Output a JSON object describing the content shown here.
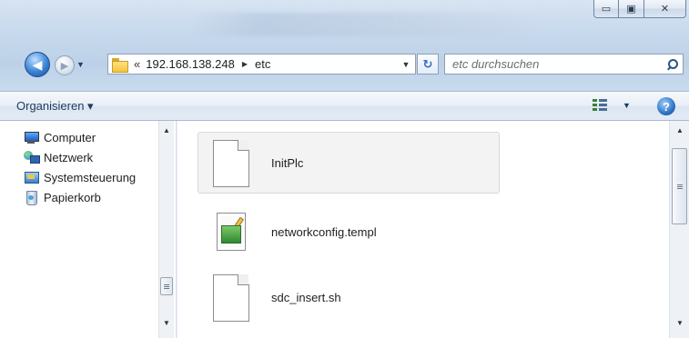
{
  "window": {
    "minimize_glyph": "▭",
    "maximize_glyph": "▣",
    "close_glyph": "✕"
  },
  "navigation": {
    "back_glyph": "◀",
    "forward_glyph": "▶",
    "recent_glyph": "▼",
    "address": {
      "overflow_chevrons": "«",
      "segments": [
        "192.168.138.248",
        "etc"
      ],
      "separator_glyph": "▶",
      "dropdown_glyph": "▼"
    },
    "refresh_glyph": "↻",
    "search_placeholder": "etc durchsuchen"
  },
  "toolbar": {
    "organize_label": "Organisieren ▾",
    "view_dropdown_glyph": "▼",
    "help_glyph": "?"
  },
  "nav_pane": {
    "items": [
      {
        "label": "Computer",
        "icon": "computer-icon"
      },
      {
        "label": "Netzwerk",
        "icon": "network-icon"
      },
      {
        "label": "Systemsteuerung",
        "icon": "control-panel-icon"
      },
      {
        "label": "Papierkorb",
        "icon": "recycle-bin-icon"
      }
    ],
    "scroll_up_glyph": "▲",
    "scroll_down_glyph": "▼"
  },
  "files": [
    {
      "name": "InitPlc",
      "icon": "generic-file-icon",
      "selected": true
    },
    {
      "name": "networkconfig.templ",
      "icon": "template-file-icon",
      "selected": false
    },
    {
      "name": "sdc_insert.sh",
      "icon": "generic-file-icon",
      "selected": false
    }
  ],
  "content_scroll": {
    "up_glyph": "▲",
    "down_glyph": "▼"
  },
  "colors": {
    "glass_top": "#d7e4f2",
    "toolbar_text": "#1e395b",
    "selection_bg": "#f3f3f3"
  }
}
